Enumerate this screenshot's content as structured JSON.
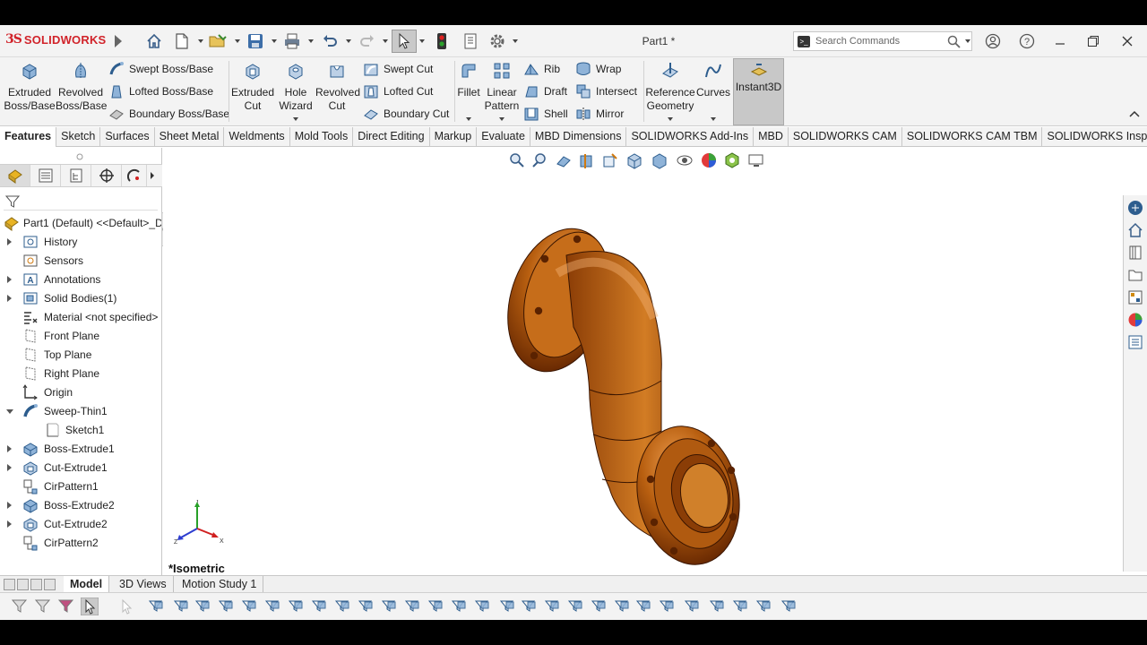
{
  "app": {
    "brand": "SOLIDWORKS",
    "brand_mark": "3S",
    "document_title": "Part1 *",
    "brand_color": "#d1232a",
    "accent_blue": "#2d6fbf",
    "part_color": "#b85f10"
  },
  "search": {
    "placeholder": "Search Commands"
  },
  "ribbon": {
    "extruded_boss": "Extruded\nBoss/Base",
    "revolved_boss": "Revolved\nBoss/Base",
    "swept_boss": "Swept Boss/Base",
    "lofted_boss": "Lofted Boss/Base",
    "boundary_boss": "Boundary Boss/Base",
    "extruded_cut": "Extruded\nCut",
    "hole_wizard": "Hole\nWizard",
    "revolved_cut": "Revolved\nCut",
    "swept_cut": "Swept Cut",
    "lofted_cut": "Lofted Cut",
    "boundary_cut": "Boundary Cut",
    "fillet": "Fillet",
    "linear_pattern": "Linear\nPattern",
    "rib": "Rib",
    "draft": "Draft",
    "shell": "Shell",
    "wrap": "Wrap",
    "intersect": "Intersect",
    "mirror": "Mirror",
    "reference_geometry": "Reference\nGeometry",
    "curves": "Curves",
    "instant3d": "Instant3D"
  },
  "tabs": [
    "Features",
    "Sketch",
    "Surfaces",
    "Sheet Metal",
    "Weldments",
    "Mold Tools",
    "Direct Editing",
    "Markup",
    "Evaluate",
    "MBD Dimensions",
    "SOLIDWORKS Add-Ins",
    "MBD",
    "SOLIDWORKS CAM",
    "SOLIDWORKS CAM TBM",
    "SOLIDWORKS Inspection"
  ],
  "active_tab": "Features",
  "tree": {
    "root": "Part1 (Default) <<Default>_D",
    "items": [
      {
        "label": "History",
        "icon": "history-icon",
        "expandable": true
      },
      {
        "label": "Sensors",
        "icon": "sensor-icon",
        "expandable": false
      },
      {
        "label": "Annotations",
        "icon": "annotation-icon",
        "expandable": true
      },
      {
        "label": "Solid Bodies(1)",
        "icon": "solid-bodies-icon",
        "expandable": true
      },
      {
        "label": "Material <not specified>",
        "icon": "material-icon",
        "expandable": false
      },
      {
        "label": "Front Plane",
        "icon": "plane-icon",
        "expandable": false
      },
      {
        "label": "Top Plane",
        "icon": "plane-icon",
        "expandable": false
      },
      {
        "label": "Right Plane",
        "icon": "plane-icon",
        "expandable": false
      },
      {
        "label": "Origin",
        "icon": "origin-icon",
        "expandable": false
      },
      {
        "label": "Sweep-Thin1",
        "icon": "sweep-icon",
        "expandable": true,
        "expanded": true
      },
      {
        "label": "Sketch1",
        "icon": "sketch-icon",
        "expandable": false,
        "child": true
      },
      {
        "label": "Boss-Extrude1",
        "icon": "extrude-icon",
        "expandable": true
      },
      {
        "label": "Cut-Extrude1",
        "icon": "cut-extrude-icon",
        "expandable": true
      },
      {
        "label": "CirPattern1",
        "icon": "circular-pattern-icon",
        "expandable": false
      },
      {
        "label": "Boss-Extrude2",
        "icon": "extrude-icon",
        "expandable": true
      },
      {
        "label": "Cut-Extrude2",
        "icon": "cut-extrude-icon",
        "expandable": true
      },
      {
        "label": "CirPattern2",
        "icon": "circular-pattern-icon",
        "expandable": false
      }
    ]
  },
  "viewport": {
    "view_name": "*Isometric",
    "triad": {
      "x": "X",
      "y": "Y",
      "z": "Z"
    }
  },
  "bottom_tabs": [
    "Model",
    "3D Views",
    "Motion Study 1"
  ],
  "active_bottom_tab": "Model"
}
